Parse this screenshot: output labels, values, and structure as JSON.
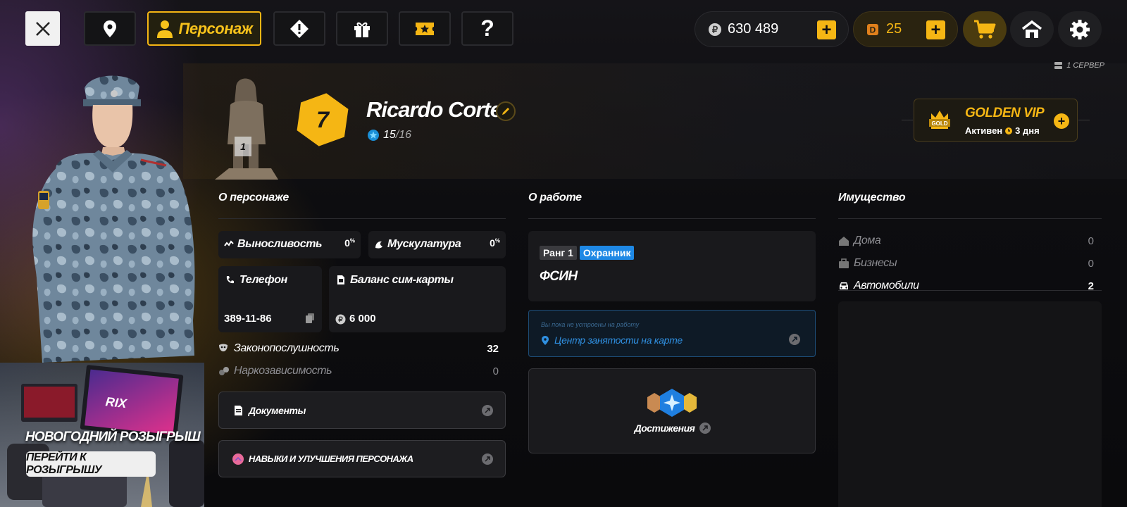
{
  "nav": {
    "active_label": "Персонаж"
  },
  "currency": {
    "money": "630 489",
    "donate": "25"
  },
  "server": "1 СЕРВЕР",
  "character": {
    "statue_rank": "1",
    "level": "7",
    "name": "Ricardo Cortez",
    "reputation": "15",
    "reputation_max": "/16"
  },
  "vip": {
    "badge": "GOLD",
    "title": "GOLDEN VIP",
    "status": "Активен",
    "days": "3 дня"
  },
  "about": {
    "title": "О персонаже",
    "stamina_label": "Выносливость",
    "stamina_value": "0",
    "muscle_label": "Мускулатура",
    "muscle_value": "0",
    "percent_sign": "%",
    "phone_label": "Телефон",
    "phone_value": "389-11-86",
    "sim_label": "Баланс сим-карты",
    "sim_value": "6 000",
    "law_label": "Законопослушность",
    "law_value": "32",
    "drug_label": "Наркозависимость",
    "drug_value": "0",
    "documents_label": "Документы",
    "skills_label": "НАВЫКИ И УЛУЧШЕНИЯ ПЕРСОНАЖА"
  },
  "work": {
    "title": "О работе",
    "rank_label": "Ранг 1",
    "position": "Охранник",
    "org": "ФСИН",
    "unemployed_hint": "Вы пока не устроены на работу",
    "employment_link": "Центр занятости на карте",
    "achievements_label": "Достижения"
  },
  "property": {
    "title": "Имущество",
    "houses_label": "Дома",
    "houses_value": "0",
    "business_label": "Бизнесы",
    "business_value": "0",
    "cars_label": "Автомобили",
    "cars_value": "2"
  },
  "promo": {
    "title": "НОВОГОДНИЙ РОЗЫГРЫШ",
    "button": "ПЕРЕЙТИ К РОЗЫГРЫШУ",
    "laptop_brand": "RIX"
  },
  "colors": {
    "accent": "#f5b614",
    "blue_tag": "#1e88e5",
    "link_blue": "#2f8fe0"
  }
}
